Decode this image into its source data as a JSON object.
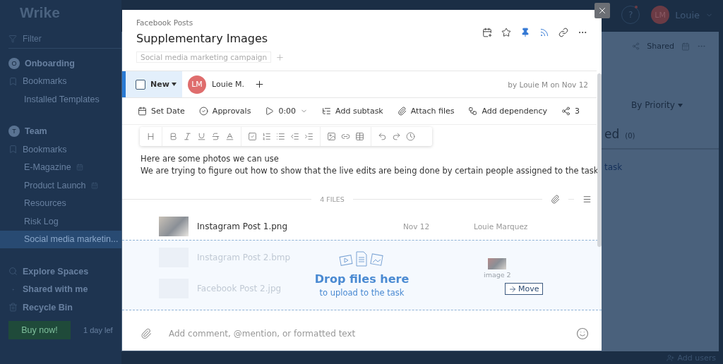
{
  "app": {
    "logo": "Wrike",
    "sidebar": {
      "filter_placeholder": "Filter",
      "groups": [
        {
          "badge": "O",
          "label": "Onboarding",
          "items": [
            {
              "kind": "bookmarks",
              "label": "Bookmarks",
              "selected": false
            },
            {
              "kind": "folder",
              "label": "Installed Templates",
              "selected": false
            }
          ]
        },
        {
          "badge": "T",
          "label": "Team",
          "items": [
            {
              "kind": "bookmarks",
              "label": "Bookmarks",
              "selected": false
            },
            {
              "kind": "project",
              "label": "E-Magazine",
              "selected": false
            },
            {
              "kind": "project",
              "label": "Product Launch",
              "selected": false
            },
            {
              "kind": "folder",
              "label": "Resources",
              "selected": false
            },
            {
              "kind": "folder",
              "label": "Risk Log",
              "selected": false
            },
            {
              "kind": "folder",
              "label": "Social media marketin...",
              "selected": true
            }
          ]
        }
      ],
      "nav": [
        {
          "kind": "explore",
          "label": "Explore Spaces"
        },
        {
          "kind": "shared",
          "label": "Shared with me"
        },
        {
          "kind": "trash",
          "label": "Recycle Bin"
        }
      ],
      "buy_button": "Buy now!",
      "trial": "1 day lef"
    },
    "topbar": {
      "help": "?",
      "help_alert": true,
      "initials": "LM",
      "user": "Louie"
    },
    "board": {
      "shared": "Shared",
      "sort": "By Priority",
      "group": "ed",
      "count": "(0)",
      "new_task": "task"
    },
    "footer": {
      "add_users": "Add users"
    }
  },
  "task": {
    "breadcrumb": "Facebook Posts",
    "title": "Supplementary Images",
    "tags": [
      "Social media marketing campaign"
    ],
    "pinned": true,
    "subscribed": true,
    "status": {
      "label": "New",
      "checked": false
    },
    "assignee": {
      "initials": "LM",
      "name": "Louie M."
    },
    "author_line": "by Louie M on Nov 12",
    "actions": [
      {
        "kind": "date",
        "label": "Set Date"
      },
      {
        "kind": "approvals",
        "label": "Approvals"
      },
      {
        "kind": "timer",
        "label": "0:00"
      },
      {
        "kind": "subtask",
        "label": "Add subtask"
      },
      {
        "kind": "attach",
        "label": "Attach files"
      },
      {
        "kind": "dependency",
        "label": "Add dependency"
      },
      {
        "kind": "share",
        "label": "3"
      }
    ],
    "description": [
      "Here are some photos we can use",
      "We are trying to figure out how to show that the live edits are being done by certain people assigned to the task"
    ],
    "files_header": "4 FILES",
    "files": [
      {
        "name": "Instagram Post 1.png",
        "date": "Nov 12",
        "author": "Louie Marquez"
      },
      {
        "name": "Instagram Post 2.bmp"
      },
      {
        "name": "Facebook Post 2.jpg"
      }
    ],
    "drop_zone": {
      "title": "Drop files here",
      "subtitle": "to upload to the task",
      "dragged_label": "image 2",
      "drag_action": "Move"
    },
    "comment_placeholder": "Add comment, @mention, or formatted text"
  }
}
